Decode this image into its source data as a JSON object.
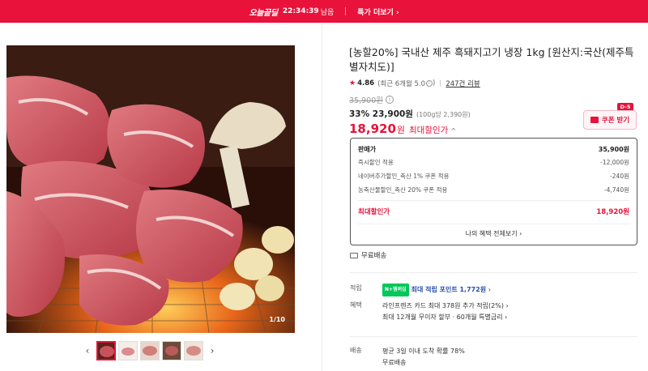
{
  "topbar": {
    "logo": "오늘끝딜",
    "time": "22:34:39",
    "remaining": "남음",
    "deal_link": "특가 더보기",
    "chevron": "›"
  },
  "gallery": {
    "counter": "1/10",
    "prev": "‹",
    "next": "›",
    "thumbnail_count": 5
  },
  "product": {
    "title": "[농할20%] 국내산 제주 흑돼지고기 냉장 1kg [원산지:국산(제주특별자치도)]",
    "rating_score": "4.86",
    "rating_recent": "(최근 6개월 5.0",
    "rating_recent_close": ")",
    "reviews": "247건 리뷰",
    "original_price": "35,900원",
    "discount_line": "33% 23,900원",
    "unit_price": "(100g당 2,390원)",
    "max_price": "18,920",
    "max_price_won": "원",
    "max_label": "최대할인가",
    "max_chevron": "^"
  },
  "coupon": {
    "dday": "D-5",
    "label": "쿠폰 받기"
  },
  "price_box": {
    "rows": [
      {
        "label": "판매가",
        "value": "35,900원"
      },
      {
        "label": "즉시할인 적용",
        "value": "-12,000원"
      },
      {
        "label": "네이버추가할인_축산 1% 쿠폰 적용",
        "value": "-240원"
      },
      {
        "label": "농축산물할인_축산 20% 쿠폰 적용",
        "value": "-4,740원"
      }
    ],
    "max_label": "최대할인가",
    "max_value": "18,920원",
    "all_benefits": "나의 혜택 전체보기",
    "all_benefits_chevron": "›"
  },
  "shipping_badge": "무료배송",
  "details": {
    "points": {
      "key": "적립",
      "badge": "N+멤버십",
      "text": "최대 적립 포인트 1,772원",
      "chevron": "›"
    },
    "benefits": {
      "key": "혜택",
      "line1": "라인프렌즈 카드 최대 378원 추가 적립(2%)",
      "line2": "최대 12개월 무이자 할부 · 60개월 특별금리",
      "chevron": "›"
    },
    "delivery": {
      "key": "배송",
      "line1": "평균 3일 이내 도착 확률 78%",
      "line2": "무료배송"
    }
  },
  "colors": {
    "accent": "#e8123a",
    "naver_green": "#03c75a"
  }
}
